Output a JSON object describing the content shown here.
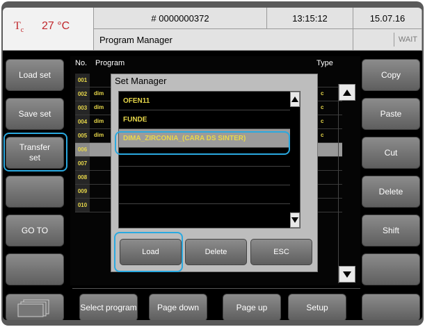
{
  "header": {
    "temp_label": "T",
    "temp_sub": "c",
    "temp_value": "27 °C",
    "program_number": "# 0000000372",
    "time": "13:15:12",
    "date": "15.07.16",
    "screen_title": "Program Manager",
    "status": "WAIT"
  },
  "left_buttons": [
    "Load set",
    "Save set",
    "Transfer set",
    "",
    "GO TO",
    ""
  ],
  "right_buttons": [
    "Copy",
    "Paste",
    "Cut",
    "Delete",
    "Shift",
    ""
  ],
  "table": {
    "col_no": "No.",
    "col_program": "Program",
    "col_type": "Type",
    "rows": [
      {
        "no": "001",
        "name": "",
        "type": ""
      },
      {
        "no": "002",
        "name": "dim",
        "type": "c"
      },
      {
        "no": "003",
        "name": "dim",
        "type": "c"
      },
      {
        "no": "004",
        "name": "dim",
        "type": "c"
      },
      {
        "no": "005",
        "name": "dim",
        "type": "c"
      },
      {
        "no": "006",
        "name": "",
        "type": ""
      },
      {
        "no": "007",
        "name": "",
        "type": ""
      },
      {
        "no": "008",
        "name": "",
        "type": ""
      },
      {
        "no": "009",
        "name": "",
        "type": ""
      },
      {
        "no": "010",
        "name": "",
        "type": ""
      }
    ]
  },
  "dialog": {
    "title": "Set Manager",
    "items": [
      "OFEN11",
      "FUNDE",
      "DIMA_ZIRCONIA_(CARA DS SINTER)",
      "",
      "",
      ""
    ],
    "selected_index": 2,
    "load": "Load",
    "delete": "Delete",
    "esc": "ESC"
  },
  "bottom": {
    "select_program": "Select program",
    "page_down": "Page down",
    "page_up": "Page up",
    "setup": "Setup"
  },
  "colors": {
    "highlight": "#2aa9e0",
    "text_yellow": "#e8d84a",
    "temp_red": "#c0262b"
  }
}
